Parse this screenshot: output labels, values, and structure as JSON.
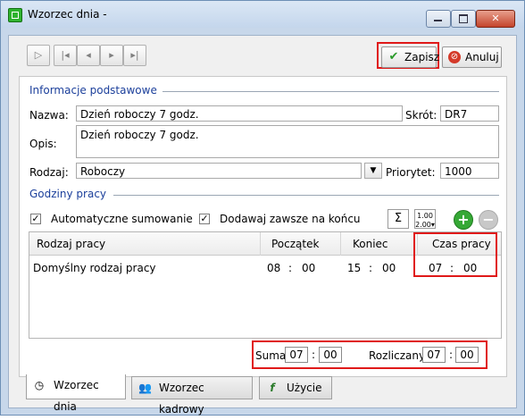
{
  "window": {
    "title": "Wzorzec dnia -"
  },
  "toolbar": {
    "save_label": "Zapisz",
    "cancel_label": "Anuluj"
  },
  "basic": {
    "section_title": "Informacje podstawowe",
    "name_label": "Nazwa:",
    "name_value": "Dzień roboczy 7 godz.",
    "short_label": "Skrót:",
    "short_value": "DR7",
    "desc_label": "Opis:",
    "desc_value": "Dzień roboczy 7 godz.",
    "type_label": "Rodzaj:",
    "type_value": "Roboczy",
    "priority_label": "Priorytet:",
    "priority_value": "1000"
  },
  "hours": {
    "section_title": "Godziny pracy",
    "auto_sum_label": "Automatyczne sumowanie",
    "auto_sum_checked": true,
    "append_label": "Dodawaj zawsze na końcu",
    "append_checked": true
  },
  "grid": {
    "columns": [
      "Rodzaj pracy",
      "Początek",
      "Koniec",
      "Czas pracy"
    ],
    "rows": [
      {
        "type": "Domyślny rodzaj pracy",
        "start_h": "08",
        "start_m": "00",
        "end_h": "15",
        "end_m": "00",
        "dur_h": "07",
        "dur_m": "00"
      }
    ]
  },
  "sum": {
    "sum_label": "Suma",
    "sum_h": "07",
    "sum_m": "00",
    "settled_label": "Rozliczany",
    "settled_h": "07",
    "settled_m": "00",
    "colon": ":"
  },
  "tabs": [
    {
      "label": "Wzorzec dnia",
      "active": true
    },
    {
      "label": "Wzorzec kadrowy",
      "active": false
    },
    {
      "label": "Użycie",
      "active": false
    }
  ],
  "colors": {
    "highlight": "#e01919",
    "section": "#1b3f9b",
    "save_check": "#2a9a2a",
    "add_button": "#35a835"
  }
}
